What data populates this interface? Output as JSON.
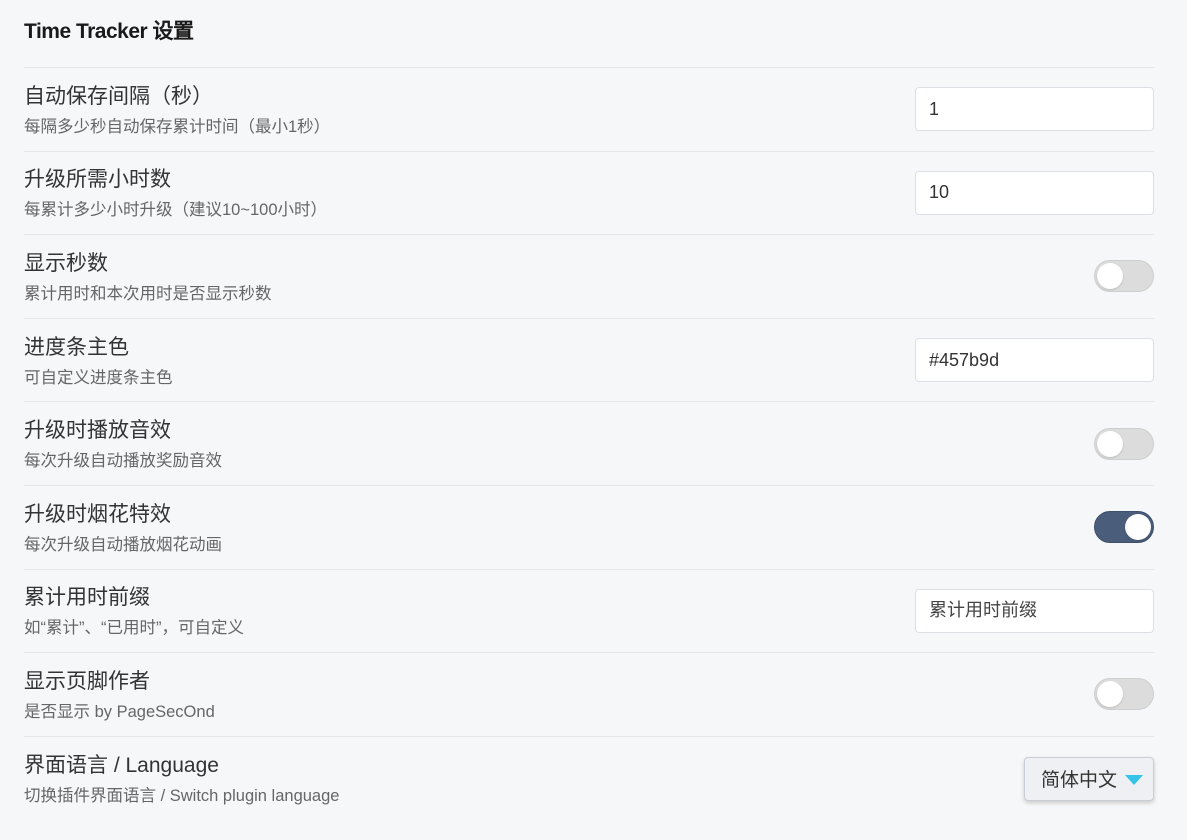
{
  "page_title": "Time Tracker 设置",
  "settings": {
    "autosave": {
      "title": "自动保存间隔（秒）",
      "desc": "每隔多少秒自动保存累计时间（最小1秒）",
      "value": "1"
    },
    "upgrade_hours": {
      "title": "升级所需小时数",
      "desc": "每累计多少小时升级（建议10~100小时）",
      "value": "10"
    },
    "show_seconds": {
      "title": "显示秒数",
      "desc": "累计用时和本次用时是否显示秒数",
      "enabled": false
    },
    "progress_color": {
      "title": "进度条主色",
      "desc": "可自定义进度条主色",
      "value": "#457b9d"
    },
    "upgrade_sound": {
      "title": "升级时播放音效",
      "desc": "每次升级自动播放奖励音效",
      "enabled": false
    },
    "fireworks": {
      "title": "升级时烟花特效",
      "desc": "每次升级自动播放烟花动画",
      "enabled": true
    },
    "prefix": {
      "title": "累计用时前缀",
      "desc": "如“累计”、“已用时”，可自定义",
      "placeholder": "累计用时前缀"
    },
    "footer_author": {
      "title": "显示页脚作者",
      "desc": "是否显示 by PageSecOnd",
      "enabled": false
    },
    "language": {
      "title": "界面语言 / Language",
      "desc": "切换插件界面语言 / Switch plugin language",
      "selected": "简体中文"
    }
  },
  "colors": {
    "toggle_on": "#4a5d7a",
    "toggle_off": "#dcdcdc",
    "caret": "#35c3e8"
  }
}
